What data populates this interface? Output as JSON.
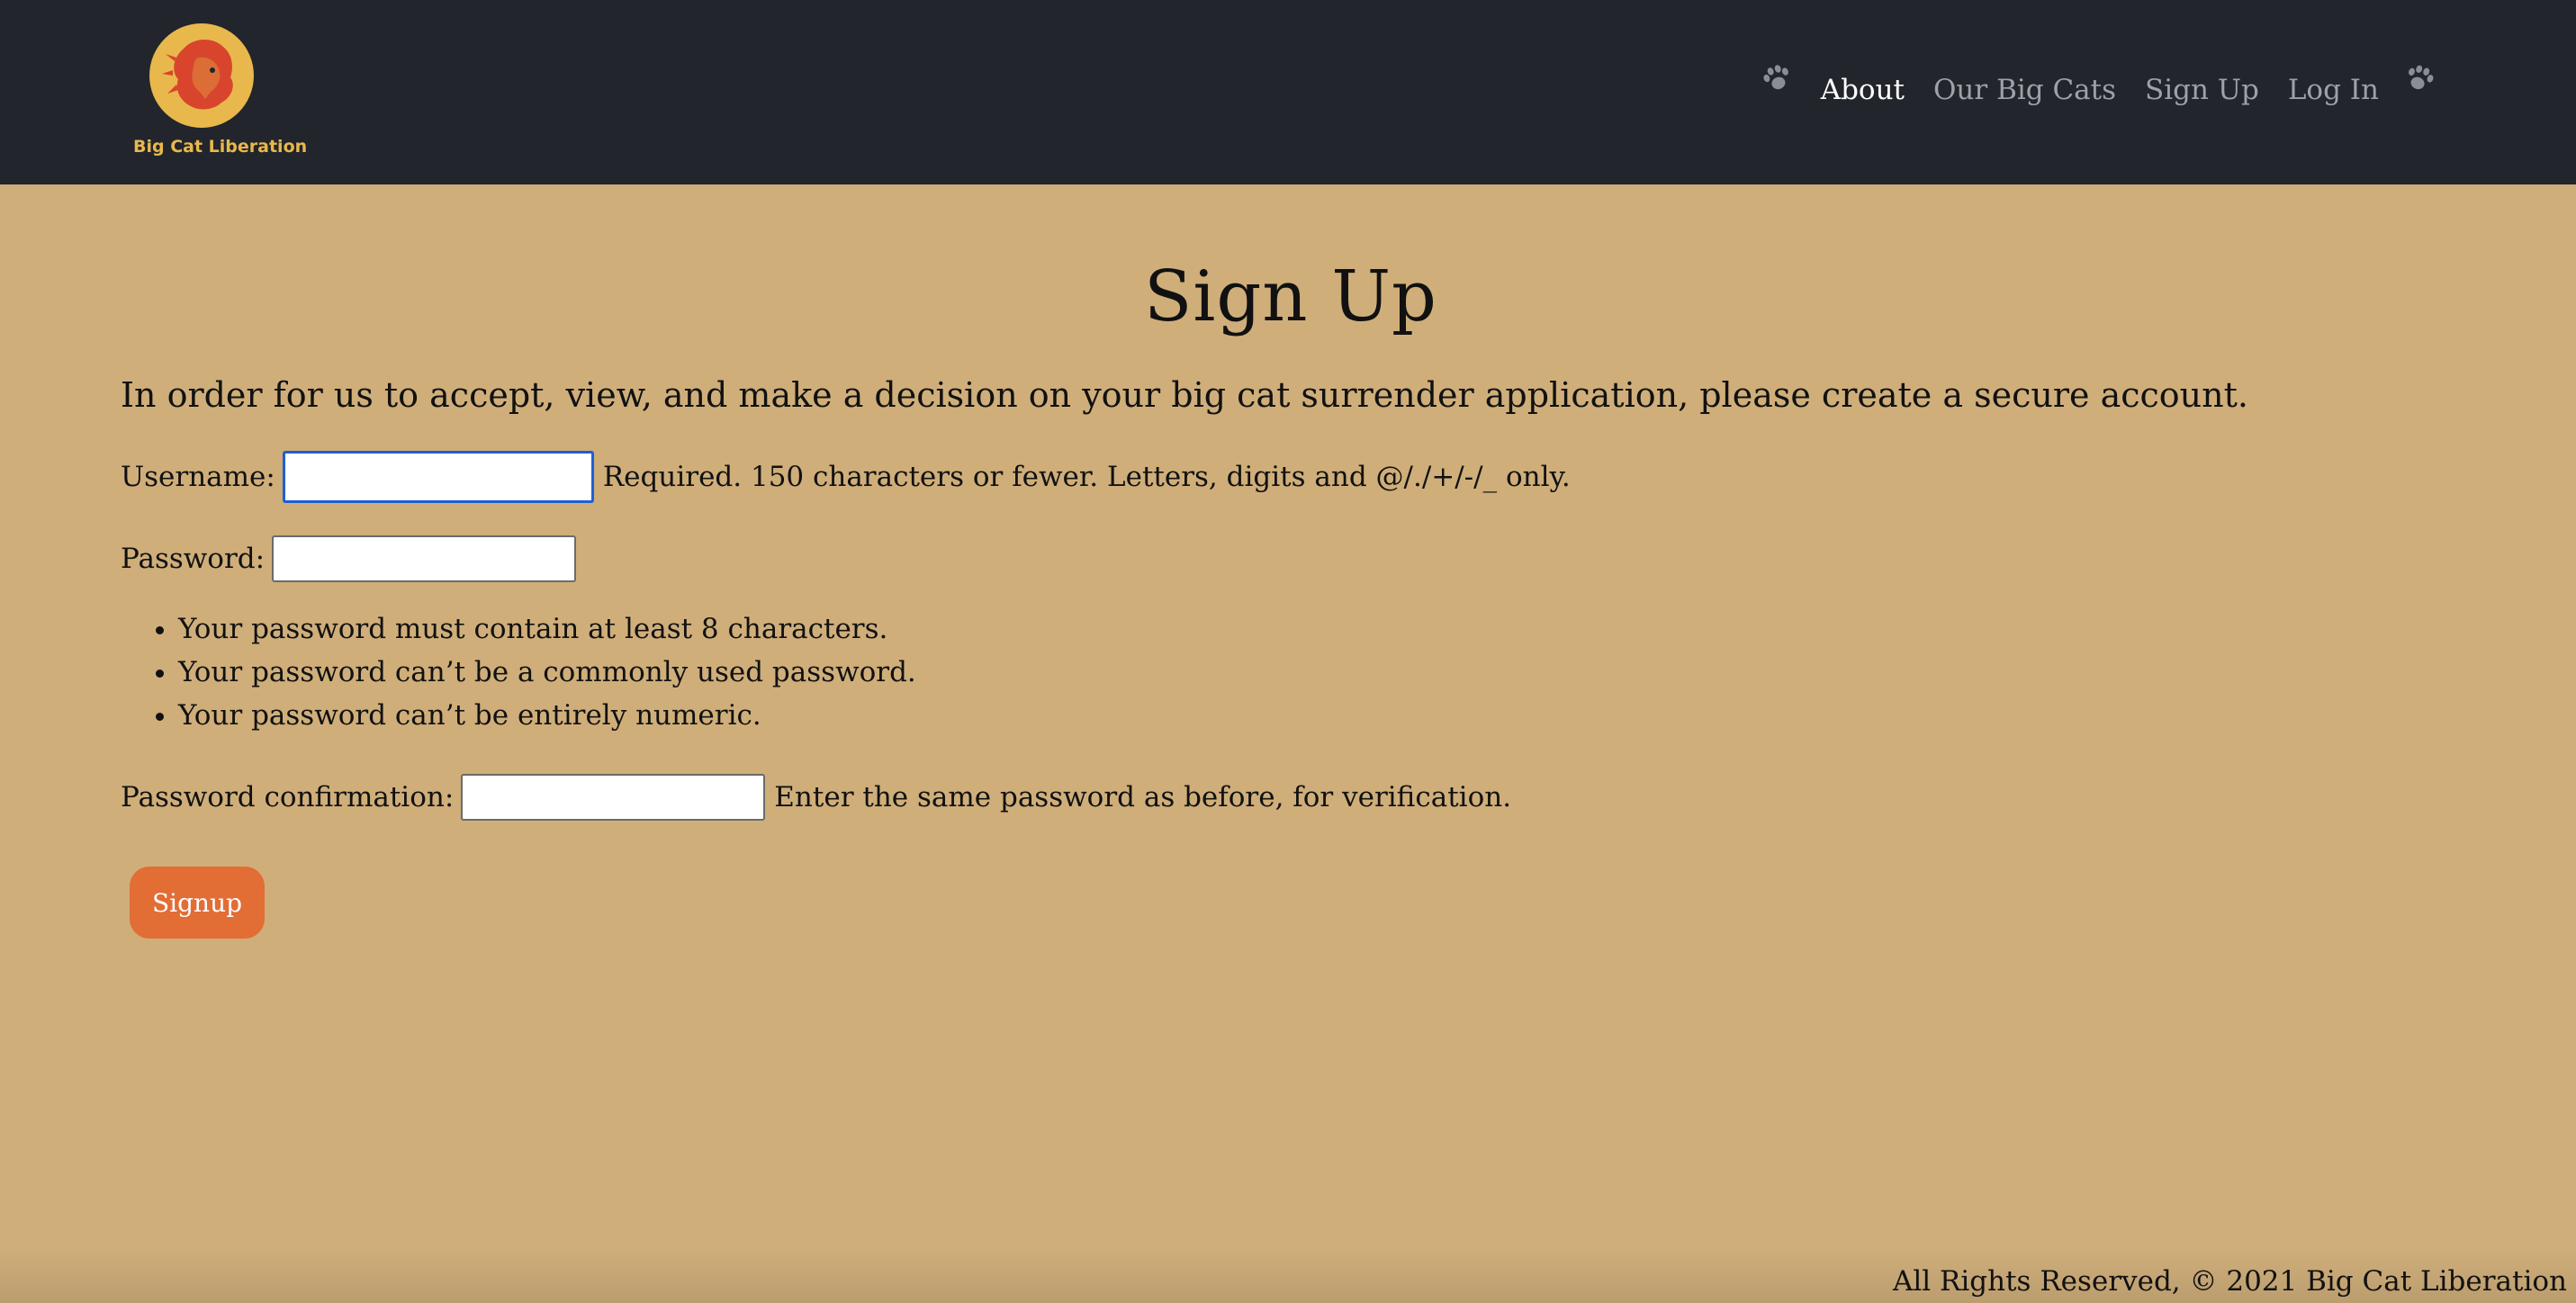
{
  "brand": {
    "name": "Big Cat Liberation",
    "logo_icon": "lion-head-icon",
    "logo_bg_color": "#e8b84c",
    "logo_fg_color": "#d8452c"
  },
  "nav": {
    "items": [
      {
        "label": "About",
        "active": true
      },
      {
        "label": "Our Big Cats",
        "active": false
      },
      {
        "label": "Sign Up",
        "active": false
      },
      {
        "label": "Log In",
        "active": false
      }
    ],
    "decor_icon": "paw-print-icon"
  },
  "page": {
    "title": "Sign Up",
    "intro": "In order for us to accept, view, and make a decision on your big cat surrender application, please create a secure account."
  },
  "form": {
    "username": {
      "label": "Username:",
      "value": "",
      "help": "Required. 150 characters or fewer. Letters, digits and @/./+/-/_ only."
    },
    "password": {
      "label": "Password:",
      "value": "",
      "rules": [
        "Your password must contain at least 8 characters.",
        "Your password can’t be a commonly used password.",
        "Your password can’t be entirely numeric."
      ]
    },
    "password_confirmation": {
      "label": "Password confirmation:",
      "value": "",
      "help": "Enter the same password as before, for verification."
    },
    "submit_label": "Signup"
  },
  "footer": {
    "text": "All Rights Reserved, © 2021 Big Cat Liberation"
  },
  "colors": {
    "navbar_bg": "#22252b",
    "page_bg": "#cfae7a",
    "button_bg": "#e26d35",
    "nav_active": "#ffffff",
    "nav_inactive": "#9ea2a8"
  }
}
